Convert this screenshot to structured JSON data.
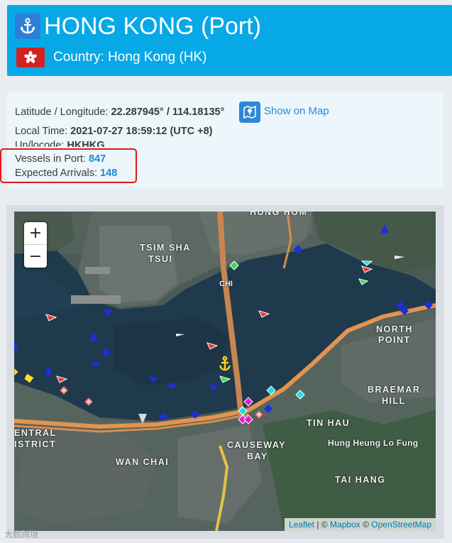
{
  "header": {
    "title": "HONG KONG (Port)",
    "country": "Country: Hong Kong (HK)",
    "colors": {
      "background": "#07a8e6",
      "flag": "#d42020"
    },
    "icons": [
      "anchor-icon",
      "flag-icon"
    ]
  },
  "info": {
    "latlon_label": "Latitude / Longitude:",
    "latlon_value": "22.287945° / 114.18135°",
    "show_on_map": "Show on Map",
    "local_time_label": "Local Time:",
    "local_time_value": "2021-07-27 18:59:12 (UTC +8)",
    "unlocode_label": "Un/locode:",
    "unlocode_value": "HKHKG",
    "vessels_label": "Vessels in Port:",
    "vessels_value": "847",
    "arrivals_label": "Expected Arrivals:",
    "arrivals_value": "148",
    "highlight_color": "#e01818"
  },
  "map": {
    "zoom_in": "+",
    "zoom_out": "−",
    "labels": {
      "tsim_sha_tsui_1": "TSIM SHA",
      "tsim_sha_tsui_2": "TSUI",
      "hung_hom": "HUNG HOM",
      "north_point_1": "NORTH",
      "north_point_2": "POINT",
      "braemar_1": "BRAEMAR",
      "braemar_2": "HILL",
      "tin_hau": "TIN HAU",
      "causeway_1": "CAUSEWAY",
      "causeway_2": "BAY",
      "central_1": "ENTRAL",
      "central_2": "ISTRICT",
      "wan_chai": "WAN CHAI",
      "hung_heung_lo_fung": "Hung Heung Lo Fung",
      "tai_hang": "TAI HANG",
      "chi": "CHI"
    },
    "attribution": {
      "leaflet": "Leaflet",
      "separator": "| ©",
      "mapbox": "Mapbox",
      "copy": "©",
      "osm": "OpenStreetMap"
    }
  },
  "watermark": "大数跨境"
}
